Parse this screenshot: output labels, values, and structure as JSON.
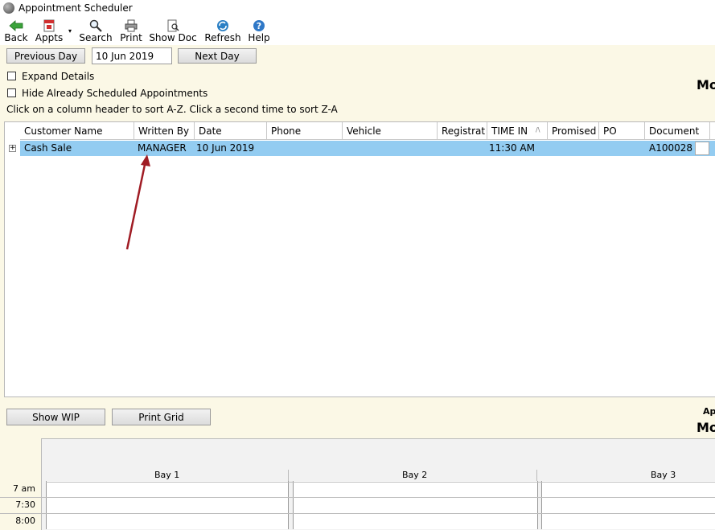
{
  "window": {
    "title": "Appointment Scheduler"
  },
  "toolbar": {
    "back": "Back",
    "appts": "Appts",
    "dropdown_glyph": "▾",
    "search": "Search",
    "print": "Print",
    "show_doc": "Show Doc",
    "refresh": "Refresh",
    "help": "Help"
  },
  "nav": {
    "previous_day": "Previous Day",
    "date_value": "10 Jun 2019",
    "next_day": "Next Day"
  },
  "options": {
    "expand_details": "Expand Details",
    "hide_scheduled": "Hide Already Scheduled Appointments",
    "sort_hint": "Click on a column header to sort A-Z.  Click a second time to sort Z-A"
  },
  "right_header": {
    "day_partial": "Mo"
  },
  "grid": {
    "columns": [
      "Customer Name",
      "Written By",
      "Date",
      "Phone",
      "Vehicle",
      "Registrat",
      "TIME IN",
      "Promised",
      "PO",
      "Document"
    ],
    "sort_glyph": "/\\",
    "rows": [
      {
        "customer": "Cash Sale",
        "written_by": "MANAGER",
        "date": "10 Jun 2019",
        "phone": "",
        "vehicle": "",
        "registration": "",
        "time_in": "11:30 AM",
        "promised": "",
        "po": "",
        "document": "A100028"
      }
    ],
    "expander_glyph": "+"
  },
  "bottom_buttons": {
    "show_wip": "Show WIP",
    "print_grid": "Print Grid"
  },
  "schedule": {
    "right_small": "Ap",
    "right_day": "Mo",
    "bays": [
      "Bay 1",
      "Bay 2",
      "Bay 3"
    ],
    "times": [
      "7 am",
      "7:30",
      "8:00"
    ]
  },
  "colors": {
    "row_highlight": "#93ccf1",
    "panel_bg": "#fbf8e6",
    "arrow": "#a01c24"
  }
}
